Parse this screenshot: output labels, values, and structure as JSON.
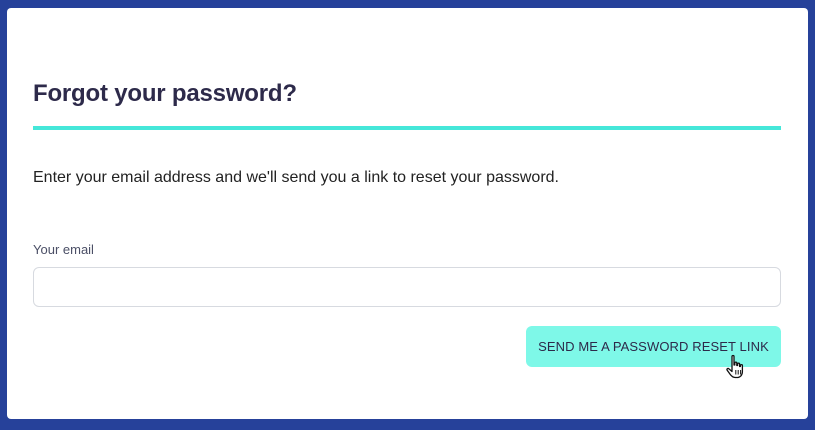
{
  "dialog": {
    "title": "Forgot your password?",
    "instructions": "Enter your email address and we'll send you a link to reset your password.",
    "email_label": "Your email",
    "email_value": "",
    "submit_label": "SEND ME A PASSWORD RESET LINK"
  },
  "colors": {
    "page_background": "#26419a",
    "card_background": "#ffffff",
    "title_rule": "#45e7d9",
    "button_background": "#7ef8e8",
    "title_text": "#2d2a4a"
  },
  "icons": {
    "cursor": "hand-pointer-icon"
  }
}
